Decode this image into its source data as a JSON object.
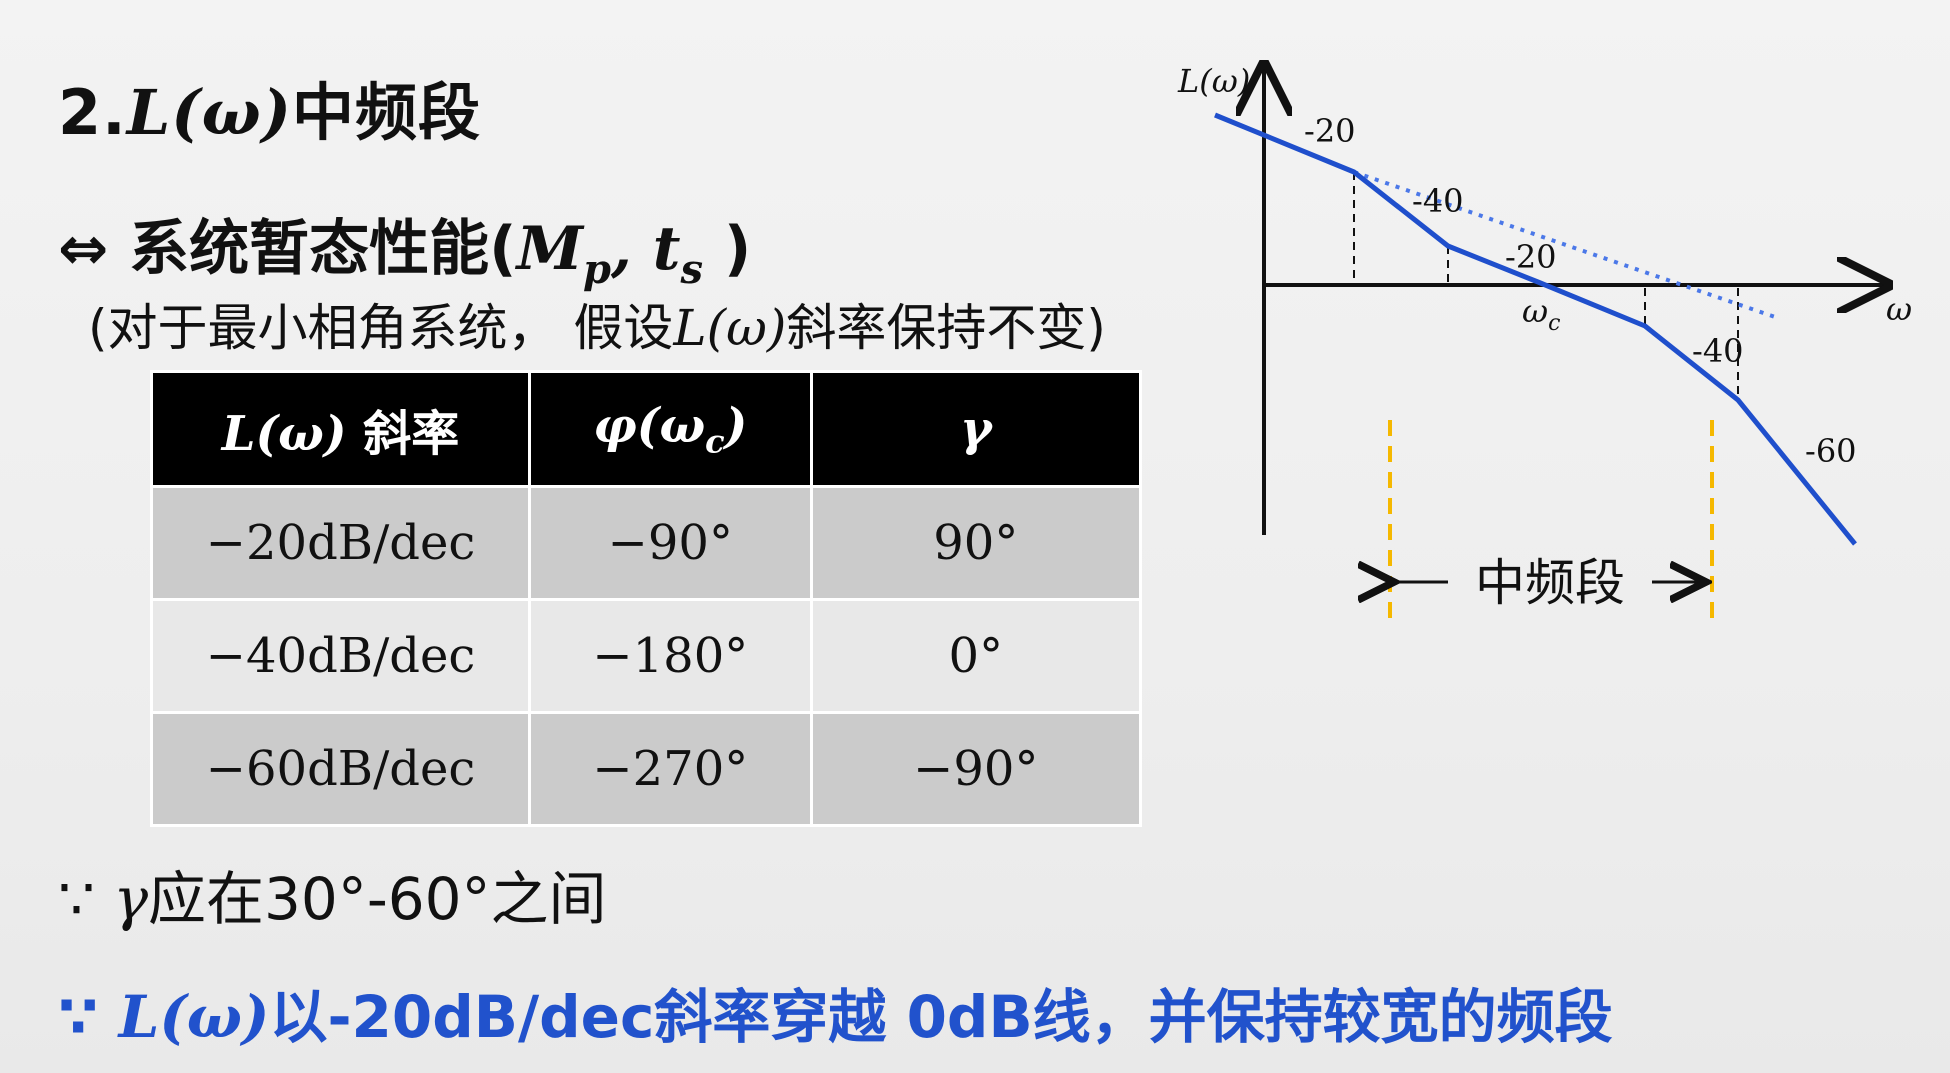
{
  "heading": {
    "number": "2.",
    "math": "L(ω)",
    "text": "中频段"
  },
  "equivalence": {
    "symbol": "⇔",
    "text": "系统暂态性能(",
    "math_m": "M",
    "math_p": "p",
    "math_sep": ", t",
    "math_s": "s",
    "close": " )"
  },
  "note": {
    "open": "(对于最小相角系统， 假设",
    "math": "L(ω)",
    "close": "斜率保持不变)"
  },
  "table": {
    "headers": {
      "slope_math": "L(ω)",
      "slope_text": " 斜率",
      "phase_phi": "φ(ω",
      "phase_sub": "c",
      "phase_close": ")",
      "margin": "γ"
    },
    "rows": [
      {
        "slope": "−20dB/dec",
        "phase": "−90°",
        "margin": "90°"
      },
      {
        "slope": "−40dB/dec",
        "phase": "−180°",
        "margin": "0°"
      },
      {
        "slope": "−60dB/dec",
        "phase": "−270°",
        "margin": "−90°"
      }
    ]
  },
  "because1": {
    "symbol": "∵ ",
    "math": "γ",
    "text": "应在30°-60°之间"
  },
  "because2": {
    "symbol": "∵ ",
    "math": "L(ω)",
    "text": "以-20dB/dec斜率穿越 0dB线，并保持较宽的频段"
  },
  "colors": {
    "asymptote": "#1f4fcc",
    "dotted": "#4b78e8",
    "band": "#f5b800",
    "accent_text": "#2152cc"
  },
  "chart_data": {
    "type": "line",
    "ylabel": "L(ω)",
    "xlabel": "ω",
    "crossover_label": "ω_c",
    "crossover_main": "ω",
    "crossover_sub": "c",
    "segment_slopes": [
      "-20",
      "-40",
      "-20",
      "-40",
      "-60"
    ],
    "band_label": "中频段"
  }
}
